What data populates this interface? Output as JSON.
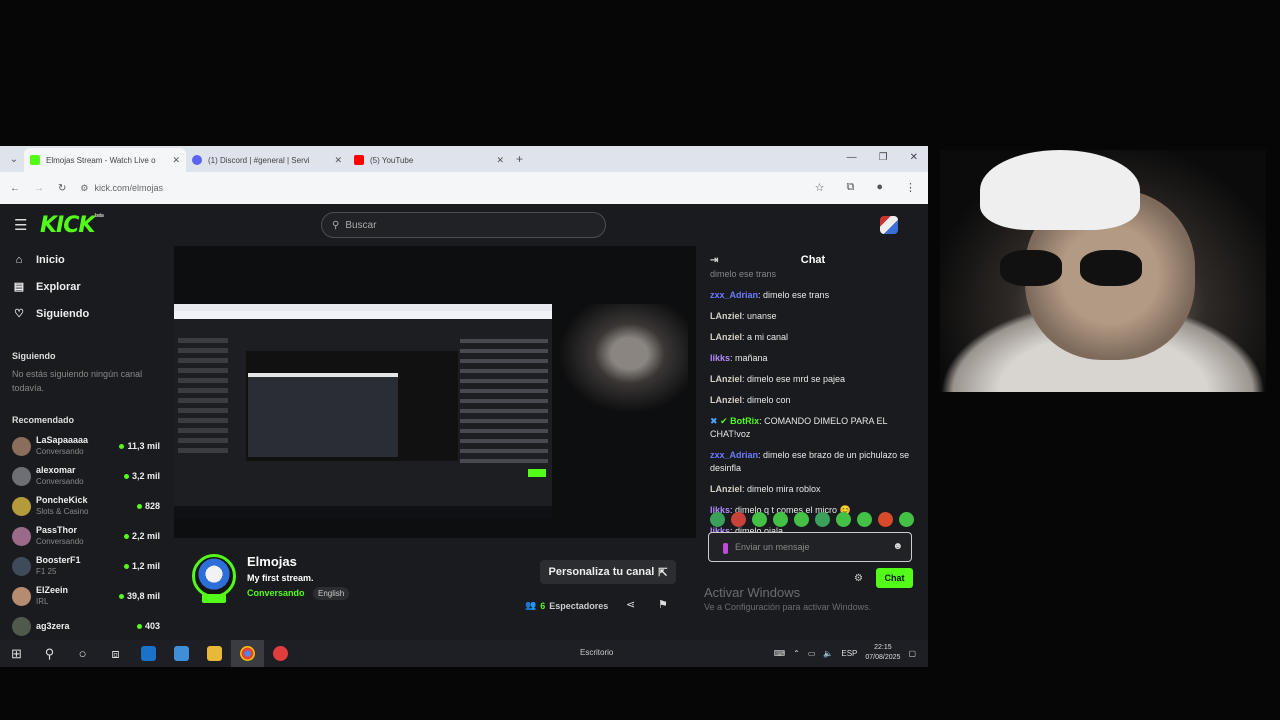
{
  "browser": {
    "tabs": [
      {
        "title": "Elmojas Stream - Watch Live o",
        "active": true,
        "favicon_color": "#53fc18"
      },
      {
        "title": "(1) Discord | #general | Servi",
        "active": false,
        "favicon_color": "#5865f2"
      },
      {
        "title": "(5) YouTube",
        "active": false,
        "favicon_color": "#ff0000"
      }
    ],
    "url": "kick.com/elmojas"
  },
  "kick": {
    "logo": "KICK",
    "logo_badge": "beta",
    "search_placeholder": "Buscar",
    "nav": [
      {
        "label": "Inicio",
        "icon": "home-icon"
      },
      {
        "label": "Explorar",
        "icon": "compass-icon"
      },
      {
        "label": "Siguiendo",
        "icon": "heart-icon"
      }
    ],
    "following_heading": "Siguiendo",
    "following_empty": "No estás siguiendo ningún canal todavía.",
    "recommended_heading": "Recomendado",
    "recommended": [
      {
        "name": "LaSapaaaaa",
        "category": "Conversando",
        "viewers": "11,3 mil",
        "color": "#8a6d5a"
      },
      {
        "name": "alexomar",
        "category": "Conversando",
        "viewers": "3,2 mil",
        "color": "#6d6f74"
      },
      {
        "name": "PoncheKick",
        "category": "Slots & Casino",
        "viewers": "828",
        "color": "#b49a3a"
      },
      {
        "name": "PassThor",
        "category": "Conversando",
        "viewers": "2,2 mil",
        "color": "#9a6a88"
      },
      {
        "name": "BoosterF1",
        "category": "F1 25",
        "viewers": "1,2 mil",
        "color": "#3f4a5a"
      },
      {
        "name": "ElZeein",
        "category": "IRL",
        "viewers": "39,8 mil",
        "color": "#b58c70"
      },
      {
        "name": "ag3zera",
        "category": "",
        "viewers": "403",
        "color": "#4f5a4a"
      }
    ],
    "channel": {
      "name": "Elmojas",
      "stream_title": "My first stream.",
      "category": "Conversando",
      "tag": "English",
      "customize_label": "Personaliza tu canal",
      "viewers_count": "6",
      "viewers_label": "Espectadores"
    },
    "chat": {
      "title": "Chat",
      "messages": [
        {
          "user": "",
          "text": "dimelo ese trans",
          "color": "#e8e8e8"
        },
        {
          "user": "zxx_Adrian",
          "text": ": dimelo ese trans",
          "color": "#6b7cff"
        },
        {
          "user": "LAnziel",
          "text": ": unanse",
          "color": "#d4cfc5"
        },
        {
          "user": "LAnziel",
          "text": ": a mi canal",
          "color": "#d4cfc5"
        },
        {
          "user": "likks",
          "text": ": mañana",
          "color": "#b08cff"
        },
        {
          "user": "LAnziel",
          "text": ": dimelo ese mrd se pajea",
          "color": "#d4cfc5"
        },
        {
          "user": "LAnziel",
          "text": ": dimelo con",
          "color": "#d4cfc5"
        },
        {
          "user": "BotRix",
          "text": ": COMANDO DIMELO PARA EL CHAT!voz",
          "color": "#53fc18"
        },
        {
          "user": "zxx_Adrian",
          "text": ": dimelo ese brazo de un pichulazo se desinfla",
          "color": "#6b7cff"
        },
        {
          "user": "LAnziel",
          "text": ": dimelo mira roblox",
          "color": "#d4cfc5"
        },
        {
          "user": "likks",
          "text": ": dimelo q t comes el micro 😊",
          "color": "#b08cff"
        },
        {
          "user": "likks",
          "text": ": dimelo ojala",
          "color": "#b08cff"
        }
      ],
      "input_placeholder": "Enviar un mensaje",
      "send_label": "Chat"
    },
    "activate_windows": {
      "title": "Activar Windows",
      "subtitle": "Ve a Configuración para activar Windows."
    }
  },
  "taskbar": {
    "desktop_label": "Escritorio",
    "lang": "ESP",
    "time": "22:15",
    "date": "07/08/2025"
  }
}
